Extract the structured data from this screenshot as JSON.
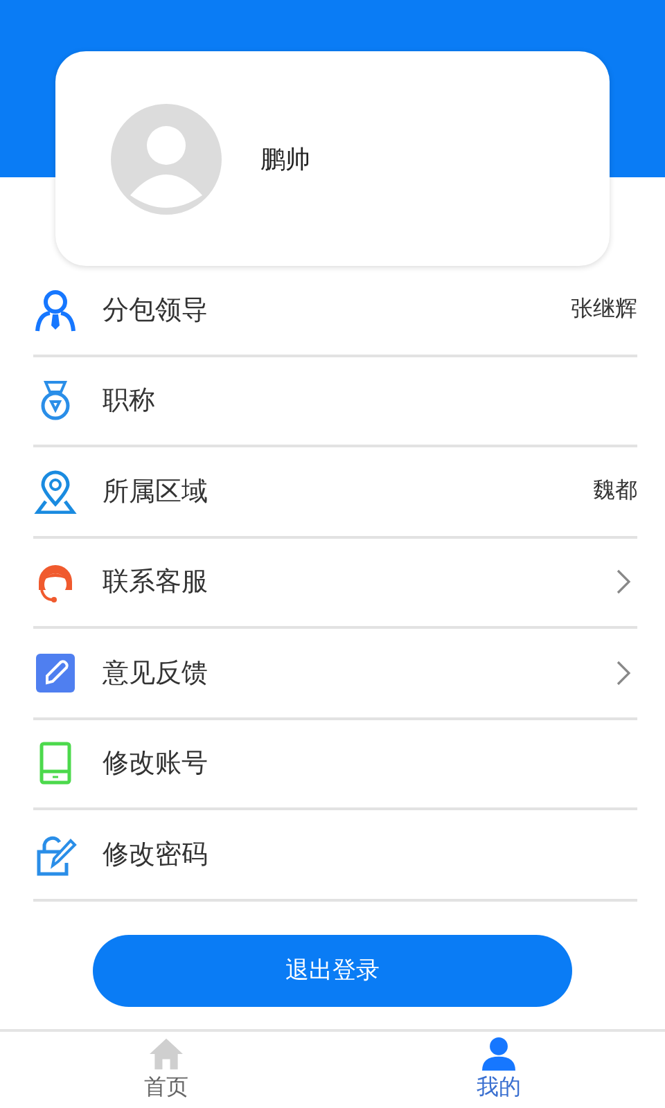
{
  "profile": {
    "name": "鹏帅"
  },
  "menu": [
    {
      "label": "分包领导",
      "kind": "value",
      "value": "张继辉"
    },
    {
      "label": "职称",
      "kind": "plain"
    },
    {
      "label": "所属区域",
      "kind": "value",
      "value": "魏都"
    },
    {
      "label": "联系客服",
      "kind": "arrow"
    },
    {
      "label": "意见反馈",
      "kind": "arrow"
    },
    {
      "label": "修改账号",
      "kind": "plain"
    },
    {
      "label": "修改密码",
      "kind": "plain"
    }
  ],
  "logout_button": "退出登录",
  "tabs": [
    {
      "label": "首页",
      "selected": false
    },
    {
      "label": "我的",
      "selected": true
    }
  ]
}
